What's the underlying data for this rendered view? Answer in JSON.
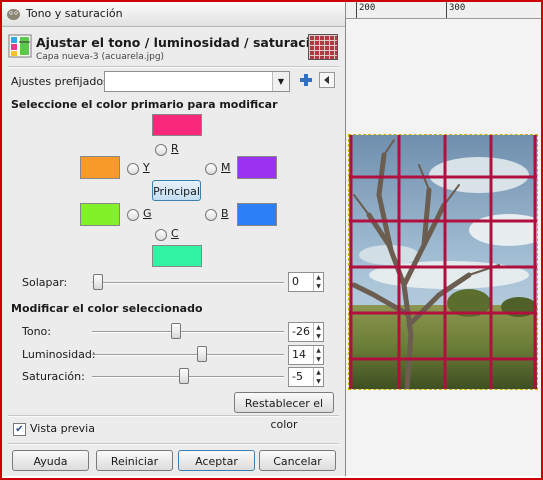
{
  "window": {
    "title": "Tono y saturación"
  },
  "header": {
    "title": "Ajustar el tono / luminosidad / saturación",
    "subtitle": "Capa nueva-3 (acuarela.jpg)"
  },
  "presets": {
    "label": "Ajustes prefijados:",
    "value": ""
  },
  "primary": {
    "heading": "Seleccione el color primario para modificar",
    "colors": {
      "R": "#f7277a",
      "Y": "#f79a2a",
      "M": "#9b31f1",
      "G": "#82f12a",
      "B": "#2d7ff5",
      "C": "#32f3a3"
    },
    "labels": {
      "R": "R",
      "Y": "Y",
      "M": "M",
      "G": "G",
      "B": "B",
      "C": "C"
    },
    "principal_label": "Principal"
  },
  "overlap": {
    "label": "Solapar:",
    "value": "0"
  },
  "modify": {
    "heading": "Modificar el color seleccionado",
    "hue": {
      "label": "Tono:",
      "value": "-26"
    },
    "lightness": {
      "label": "Luminosidad:",
      "value": "14"
    },
    "saturation": {
      "label": "Saturación:",
      "value": "-5"
    },
    "reset_label": "Restablecer el color"
  },
  "preview": {
    "label": "Vista previa",
    "checked": true
  },
  "buttons": {
    "help": "Ayuda",
    "reset": "Reiniciar",
    "ok": "Aceptar",
    "cancel": "Cancelar"
  },
  "ruler": {
    "marks": [
      "200",
      "300"
    ]
  },
  "accent": "#d00000"
}
